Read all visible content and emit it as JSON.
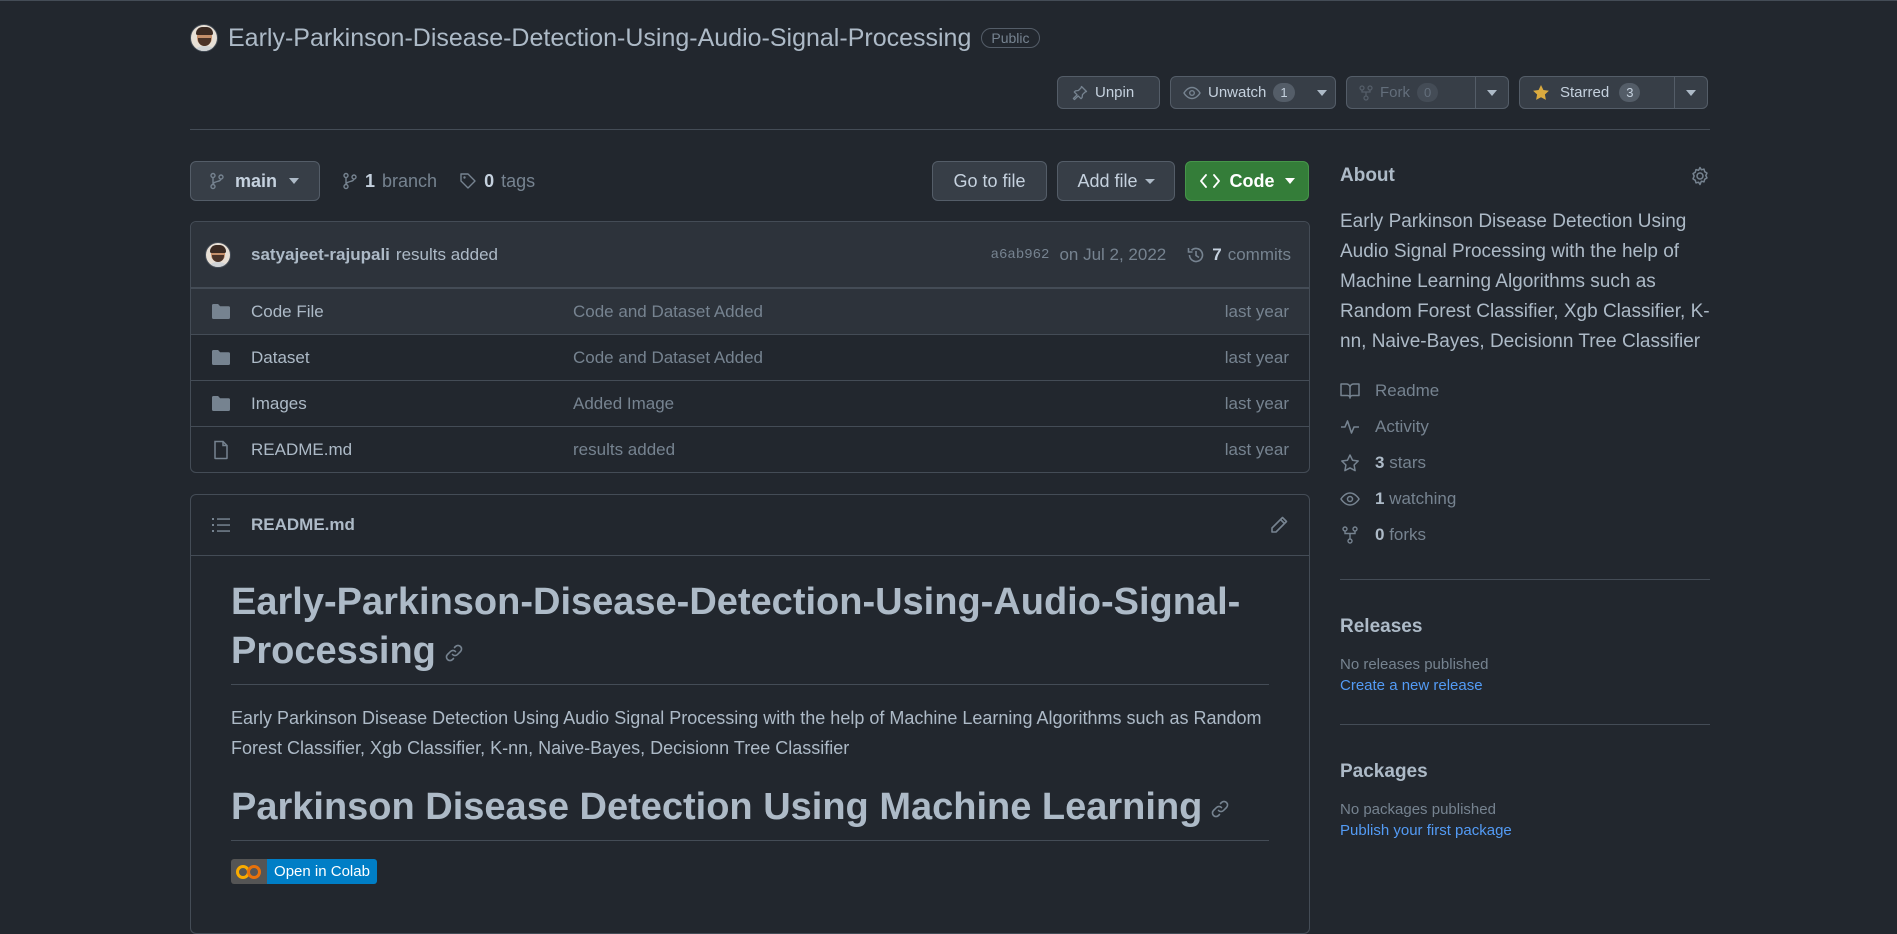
{
  "repo": {
    "name": "Early-Parkinson-Disease-Detection-Using-Audio-Signal-Processing",
    "visibility": "Public"
  },
  "actions": {
    "unpin": "Unpin",
    "unwatch": "Unwatch",
    "watch_count": "1",
    "fork": "Fork",
    "fork_count": "0",
    "starred": "Starred",
    "star_count": "3"
  },
  "branchbar": {
    "branch": "main",
    "branch_count": "1",
    "branch_label": "branch",
    "tag_count": "0",
    "tag_label": "tags",
    "go_to_file": "Go to file",
    "add_file": "Add file",
    "code": "Code"
  },
  "commit": {
    "author": "satyajeet-rajupali",
    "message": "results added",
    "sha": "a6ab962",
    "date": "on Jul 2, 2022",
    "commit_count": "7",
    "commit_label": "commits"
  },
  "files": [
    {
      "type": "folder",
      "name": "Code File",
      "message": "Code and Dataset Added",
      "age": "last year"
    },
    {
      "type": "folder",
      "name": "Dataset",
      "message": "Code and Dataset Added",
      "age": "last year"
    },
    {
      "type": "folder",
      "name": "Images",
      "message": "Added Image",
      "age": "last year"
    },
    {
      "type": "file",
      "name": "README.md",
      "message": "results added",
      "age": "last year"
    }
  ],
  "readme": {
    "filename": "README.md",
    "h1": "Early-Parkinson-Disease-Detection-Using-Audio-Signal-Processing",
    "paragraph": "Early Parkinson Disease Detection Using Audio Signal Processing with the help of Machine Learning Algorithms such as Random Forest Classifier, Xgb Classifier, K-nn, Naive-Bayes, Decisionn Tree Classifier",
    "h2": "Parkinson Disease Detection Using Machine Learning",
    "badge": "Open in Colab"
  },
  "about": {
    "title": "About",
    "description": "Early Parkinson Disease Detection Using Audio Signal Processing with the help of Machine Learning Algorithms such as Random Forest Classifier, Xgb Classifier, K-nn, Naive-Bayes, Decisionn Tree Classifier",
    "readme": "Readme",
    "activity": "Activity",
    "stars_count": "3",
    "stars_label": "stars",
    "watching_count": "1",
    "watching_label": "watching",
    "forks_count": "0",
    "forks_label": "forks"
  },
  "releases": {
    "title": "Releases",
    "empty": "No releases published",
    "link": "Create a new release"
  },
  "packages": {
    "title": "Packages",
    "empty": "No packages published",
    "link": "Publish your first package"
  },
  "colors": {
    "background": "#22272e",
    "border": "#444c56",
    "green_button": "#347d39",
    "link": "#539bf5",
    "star": "#daaa3f"
  }
}
